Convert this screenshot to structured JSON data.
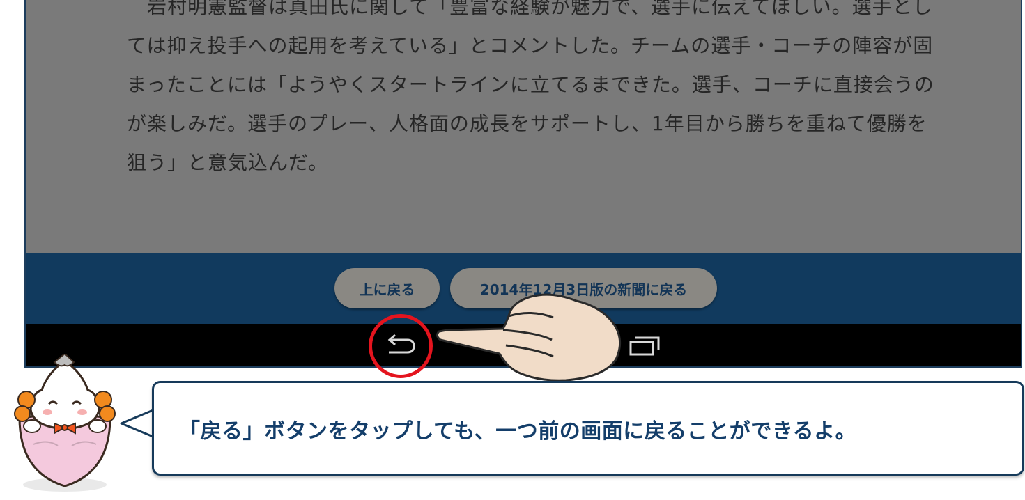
{
  "article": {
    "paragraph": "　岩村明憲監督は真田氏に関して「豊富な経験が魅力で、選手に伝えてほしい。選手としては抑え投手への起用を考えている」とコメントした。チームの選手・コーチの陣容が固まったことには「ようやくスタートラインに立てるまできた。選手、コーチに直接会うのが楽しみだ。選手のプレー、人格面の成長をサポートし、1年目から勝ちを重ねて優勝を狙う」と意気込んだ。"
  },
  "footer": {
    "up_button": "上に戻る",
    "back_to_paper_button": "2014年12月3日版の新聞に戻る"
  },
  "navbar": {
    "back_icon": "back-arrow-icon",
    "recent_icon": "recent-apps-icon"
  },
  "callout": {
    "text": "「戻る」ボタンをタップしても、一つ前の画面に戻ることができるよ。"
  },
  "colors": {
    "footer_bar": "#113a5e",
    "highlight_ring": "#e4141e",
    "callout_text": "#143e6a"
  }
}
